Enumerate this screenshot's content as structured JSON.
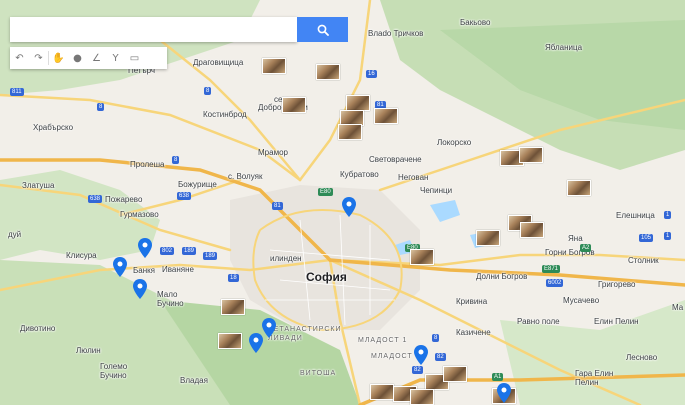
{
  "search": {
    "placeholder": "",
    "value": ""
  },
  "toolbar": {
    "tools": [
      {
        "name": "undo-icon",
        "glyph": "↶"
      },
      {
        "name": "redo-icon",
        "glyph": "↷"
      },
      {
        "name": "pan-hand-icon",
        "glyph": "✋"
      },
      {
        "name": "marker-icon",
        "glyph": "●"
      },
      {
        "name": "draw-line-icon",
        "glyph": "∠"
      },
      {
        "name": "route-icon",
        "glyph": "Y"
      },
      {
        "name": "ruler-icon",
        "glyph": "▭"
      }
    ]
  },
  "map": {
    "city": "София",
    "places": {
      "bankya": "Банкя",
      "vlado_trichkov": "Влado Тричков",
      "bakyovo": "Бакьово",
      "ablanitsa": "Ябланица",
      "petarch": "Петърч",
      "dragovishtitsa": "Драговищица",
      "selo": "село",
      "dobroslavtsi": "Доброславци",
      "kostinbrod": "Костинброд",
      "hrabarsko": "Храбърско",
      "mramor": "Мрамор",
      "lokorsko": "Локорско",
      "svetovrachene": "Световрачене",
      "proleshe": "Пролеша",
      "kubratovo": "Кубратово",
      "negovan": "Негован",
      "zlatusha": "Златуша",
      "bozhurishte": "Божурище",
      "chepintsi": "Чепинци",
      "volyak": "с. Волуяк",
      "pozharevo": "Пожарево",
      "gurmazovo": "Гурмазово",
      "eleshnitsa": "Елешница",
      "duy": "дуй",
      "klisura": "Клисура",
      "ivanyane": "Иваняне",
      "iliyantsi": "илинден",
      "yana": "Яна",
      "gorni_bogrov": "Горни Богров",
      "dolni_bogrov": "Долни Богров",
      "stolnik": "Столник",
      "grigorevo": "Григорево",
      "malo_buchino": "Мало\nБучино",
      "krivina": "Кривина",
      "musachevo": "Мусачево",
      "ravno_pole": "Равно поле",
      "elin_pelin": "Елин Пелин",
      "divotino": "Дивотино",
      "kazichene": "Казичене",
      "mladost": "МЛАДОСТ",
      "mladost1": "МЛАДОСТ 1",
      "lyulin": "Люлин",
      "golemo_buchino": "Големо\nБучино",
      "vitosha": "ВИТОША",
      "vladaya": "Владая",
      "lesnovo": "Лесново",
      "gara_elin_pelin": "Гара Елин\nПелин",
      "ovcha_kupel_pivadi": "ВЕТАНАСТИРСКИ\nЛИВАДИ",
      "ma": "Ма"
    },
    "shields": [
      "811",
      "8",
      "8",
      "81",
      "16",
      "638",
      "638",
      "E80",
      "81",
      "802",
      "189",
      "189",
      "18",
      "8",
      "82",
      "8",
      "A1",
      "A2",
      "E871",
      "6002",
      "105",
      "1",
      "1",
      "E80",
      "82"
    ]
  },
  "colors": {
    "land": "#f2efe9",
    "green": "#cfe3c0",
    "forest": "#b8d8a8",
    "road": "#f7d57a",
    "motorway": "#f0b64a",
    "water": "#aadaff",
    "pin": "#1a73e8",
    "search": "#4285f4"
  }
}
